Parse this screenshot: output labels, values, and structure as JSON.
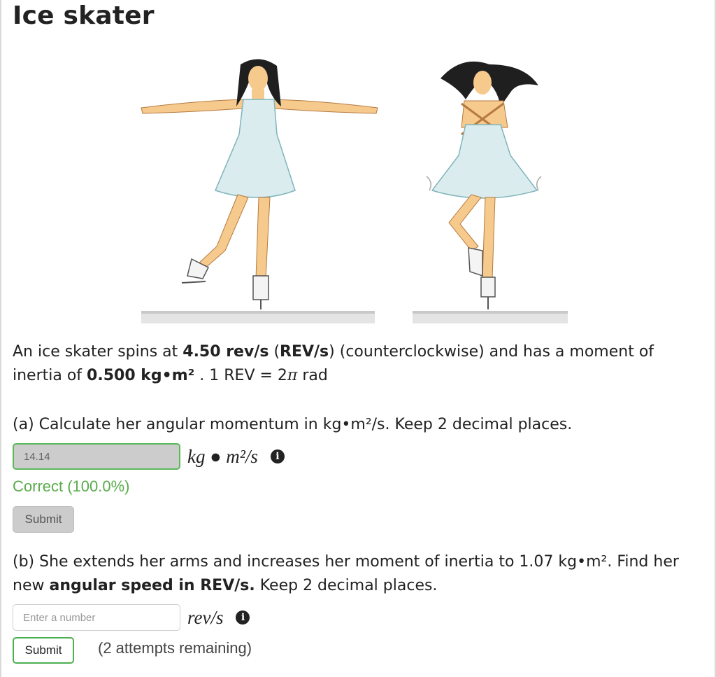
{
  "page": {
    "title": "Ice skater"
  },
  "problem": {
    "intro_prefix": "An ice skater spins at ",
    "spin_rate": "4.50 rev/s",
    "spin_unit_open": " (",
    "spin_unit": "REV/s",
    "spin_unit_close": ")",
    "intro_middle": " (counterclockwise) and has a moment of inertia of ",
    "inertia": "0.500 kg•m²",
    "intro_suffix": " .  1 REV = 2",
    "pi_symbol": "π",
    "rad_text": " rad"
  },
  "part_a": {
    "question": "(a) Calculate her angular momentum in kg•m²/s. Keep 2 decimal places.",
    "answer_value": "14.14",
    "units": "kg ● m²/s",
    "info_icon": "info-icon",
    "status": "Correct (100.0%)",
    "submit_label": "Submit"
  },
  "part_b": {
    "question_prefix": "(b) She extends her arms and increases her moment of inertia to 1.07 kg•m². Find her new ",
    "question_bold": "angular speed in REV/s.",
    "question_suffix": "  Keep 2 decimal places.",
    "answer_placeholder": "Enter a number",
    "units": "rev/s",
    "info_icon": "info-icon",
    "submit_label": "Submit",
    "attempts": "(2 attempts remaining)"
  },
  "colors": {
    "correct_green": "#5aab4b",
    "submit_border_green": "#4caf50",
    "dress_blue": "#dbecef",
    "skin": "#f6c98d",
    "hair": "#1f1f1f"
  }
}
